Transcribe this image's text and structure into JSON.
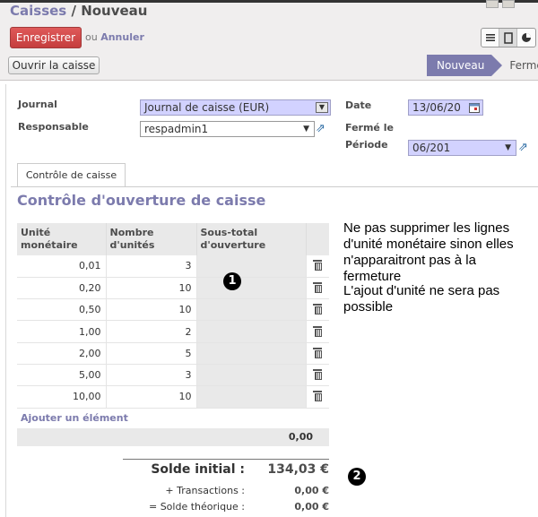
{
  "breadcrumb": {
    "parent": "Caisses",
    "separator": "/",
    "current": "Nouveau"
  },
  "toolbar": {
    "save_label": "Enregistrer",
    "or_label": "ou",
    "cancel_label": "Annuler"
  },
  "actions": {
    "open_label": "Ouvrir la caisse"
  },
  "status": {
    "active": "Nouveau",
    "next": "Fermé"
  },
  "form": {
    "journal_label": "Journal",
    "journal_value": "Journal de caisse (EUR)",
    "responsable_label": "Responsable",
    "responsable_value": "respadmin1",
    "date_label": "Date",
    "date_value": "13/06/20",
    "ferme_label": "Fermé le",
    "periode_label": "Période",
    "periode_value": "06/201"
  },
  "tab": {
    "label": "Contrôle de caisse"
  },
  "section": {
    "title": "Contrôle d'ouverture de caisse"
  },
  "table": {
    "headers": [
      "Unité monétaire",
      "Nombre d'unités",
      "Sous-total d'ouverture"
    ],
    "rows": [
      {
        "unit": "0,01",
        "count": "3"
      },
      {
        "unit": "0,20",
        "count": "10"
      },
      {
        "unit": "0,50",
        "count": "10"
      },
      {
        "unit": "1,00",
        "count": "2"
      },
      {
        "unit": "2,00",
        "count": "5"
      },
      {
        "unit": "5,00",
        "count": "3"
      },
      {
        "unit": "10,00",
        "count": "10"
      }
    ],
    "add_label": "Ajouter un élément",
    "total": "0,00"
  },
  "summary": {
    "initial_label": "Solde initial :",
    "initial_value": "134,03 €",
    "transactions_label": "+ Transactions :",
    "transactions_value": "0,00 €",
    "theoretical_label": "= Solde théorique :",
    "theoretical_value": "0,00 €"
  },
  "notes": {
    "note1": "Ne pas supprimer les lignes d'unité monétaire sinon elles n'apparaitront pas à la fermeture",
    "note2": "L'ajout d'unité ne sera pas possible"
  },
  "badges": {
    "one": "1",
    "two": "2"
  },
  "colors": {
    "accent": "#7c7bad",
    "save": "#d44c4c",
    "required": "#d2d2ff"
  }
}
